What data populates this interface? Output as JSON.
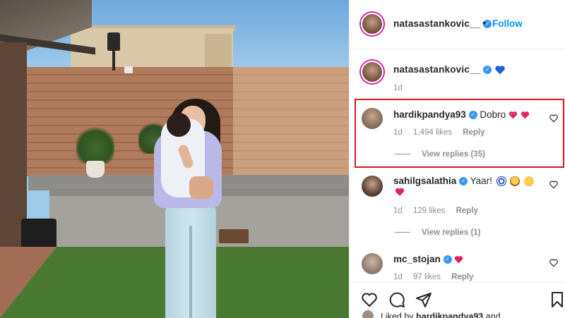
{
  "post": {
    "author": "natasastankovic__",
    "follow_label": "Follow",
    "separator": "•"
  },
  "caption": {
    "username": "natasastankovic__",
    "emoji": "blue-heart",
    "age": "1d"
  },
  "comments": [
    {
      "username": "hardikpandya93",
      "text": "Dobro",
      "emojis": [
        "sparkling-heart",
        "red-heart"
      ],
      "age": "1d",
      "likes": "1,494 likes",
      "reply_label": "Reply",
      "view_replies": "View replies (35)",
      "highlighted": true
    },
    {
      "username": "sahilgsalathia",
      "text": "Yaar!",
      "emojis": [
        "nazar-amulet",
        "face-with-hands",
        "blushing-face",
        "heart-exclamation"
      ],
      "age": "1d",
      "likes": "129 likes",
      "reply_label": "Reply",
      "view_replies": "View replies (1)",
      "highlighted": false
    },
    {
      "username": "mc_stojan",
      "text": "",
      "emojis": [
        "red-heart"
      ],
      "age": "1d",
      "likes": "97 likes",
      "reply_label": "Reply",
      "highlighted": false
    }
  ],
  "actions": {
    "icons": [
      "heart-outline-icon",
      "comment-icon",
      "share-icon",
      "bookmark-icon"
    ]
  },
  "liked_by": {
    "prefix": "Liked by",
    "username": "hardikpandya93",
    "suffix": "and"
  },
  "colors": {
    "accent_blue": "#0095f6",
    "verified_blue": "#3897f0",
    "highlight_red": "#d8161c",
    "heart_red": "#ed4956",
    "muted_text": "#8e8e8e"
  }
}
